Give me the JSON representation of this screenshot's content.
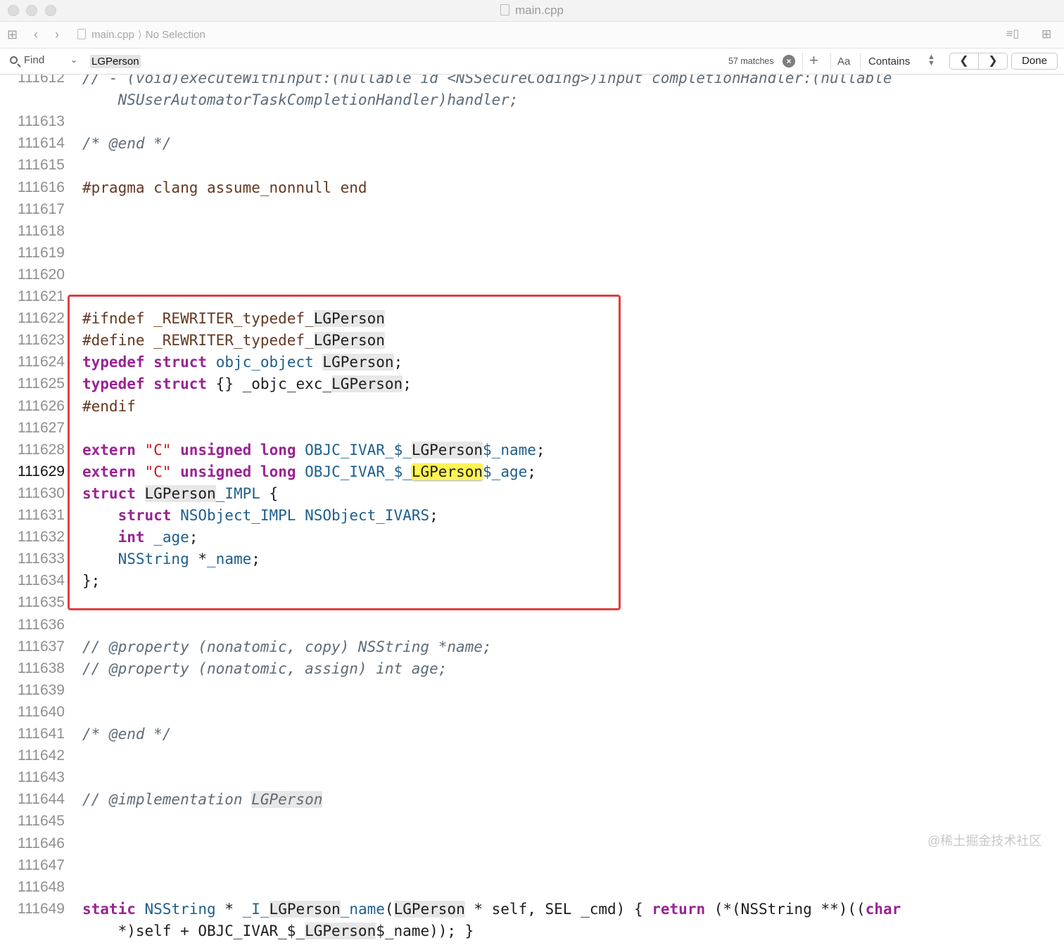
{
  "window": {
    "title": "main.cpp"
  },
  "jumpbar": {
    "file": "main.cpp",
    "selection": "No Selection"
  },
  "findbar": {
    "mode": "Find",
    "query": "LGPerson",
    "match_count": "57 matches",
    "case_label": "Aa",
    "match_type": "Contains",
    "done_label": "Done"
  },
  "editor": {
    "current_line": "111629",
    "lines": [
      {
        "num": "111612",
        "segs": [
          [
            "cmt",
            "// - (void)executeWithInput:(nullable id <NSSecureCoding>)input completionHandler:(nullable"
          ]
        ]
      },
      {
        "num": "",
        "segs": [
          [
            "cmt",
            "    NSUserAutomatorTaskCompletionHandler)handler;"
          ]
        ]
      },
      {
        "num": "111613",
        "segs": []
      },
      {
        "num": "111614",
        "segs": [
          [
            "cmt",
            "/* @end */"
          ]
        ]
      },
      {
        "num": "111615",
        "segs": []
      },
      {
        "num": "111616",
        "segs": [
          [
            "pp",
            "#pragma clang assume_nonnull end"
          ]
        ]
      },
      {
        "num": "111617",
        "segs": []
      },
      {
        "num": "111618",
        "segs": []
      },
      {
        "num": "111619",
        "segs": []
      },
      {
        "num": "111620",
        "segs": []
      },
      {
        "num": "111621",
        "segs": []
      },
      {
        "num": "111622",
        "segs": [
          [
            "pp",
            "#ifndef _REWRITER_typedef_"
          ],
          [
            "hl",
            "LGPerson"
          ]
        ]
      },
      {
        "num": "111623",
        "segs": [
          [
            "pp",
            "#define _REWRITER_typedef_"
          ],
          [
            "hl",
            "LGPerson"
          ]
        ]
      },
      {
        "num": "111624",
        "segs": [
          [
            "kw",
            "typedef"
          ],
          [
            "pl",
            " "
          ],
          [
            "kw",
            "struct"
          ],
          [
            "pl",
            " "
          ],
          [
            "ty",
            "objc_object"
          ],
          [
            "pl",
            " "
          ],
          [
            "hl",
            "LGPerson"
          ],
          [
            "pl",
            ";"
          ]
        ]
      },
      {
        "num": "111625",
        "segs": [
          [
            "kw",
            "typedef"
          ],
          [
            "pl",
            " "
          ],
          [
            "kw",
            "struct"
          ],
          [
            "pl",
            " {} _objc_exc_"
          ],
          [
            "hl",
            "LGPerson"
          ],
          [
            "pl",
            ";"
          ]
        ]
      },
      {
        "num": "111626",
        "segs": [
          [
            "pp",
            "#endif"
          ]
        ]
      },
      {
        "num": "111627",
        "segs": []
      },
      {
        "num": "111628",
        "segs": [
          [
            "kw",
            "extern"
          ],
          [
            "pl",
            " "
          ],
          [
            "str",
            "\"C\""
          ],
          [
            "pl",
            " "
          ],
          [
            "kw",
            "unsigned"
          ],
          [
            "pl",
            " "
          ],
          [
            "kw",
            "long"
          ],
          [
            "pl",
            " "
          ],
          [
            "ty",
            "OBJC_IVAR_$_"
          ],
          [
            "hl",
            "LGPerson"
          ],
          [
            "ty",
            "$_name"
          ],
          [
            "pl",
            ";"
          ]
        ]
      },
      {
        "num": "111629",
        "segs": [
          [
            "kw",
            "extern"
          ],
          [
            "pl",
            " "
          ],
          [
            "str",
            "\"C\""
          ],
          [
            "pl",
            " "
          ],
          [
            "kw",
            "unsigned"
          ],
          [
            "pl",
            " "
          ],
          [
            "kw",
            "long"
          ],
          [
            "pl",
            " "
          ],
          [
            "ty",
            "OBJC_IVAR_$_"
          ],
          [
            "hlcur",
            "LGPerson"
          ],
          [
            "ty",
            "$_age"
          ],
          [
            "pl",
            ";"
          ]
        ]
      },
      {
        "num": "111630",
        "segs": [
          [
            "kw",
            "struct"
          ],
          [
            "pl",
            " "
          ],
          [
            "hl",
            "LGPerson"
          ],
          [
            "ty",
            "_IMPL"
          ],
          [
            "pl",
            " {"
          ]
        ]
      },
      {
        "num": "111631",
        "segs": [
          [
            "pl",
            "    "
          ],
          [
            "kw",
            "struct"
          ],
          [
            "pl",
            " "
          ],
          [
            "ty",
            "NSObject_IMPL"
          ],
          [
            "pl",
            " "
          ],
          [
            "ty",
            "NSObject_IVARS"
          ],
          [
            "pl",
            ";"
          ]
        ]
      },
      {
        "num": "111632",
        "segs": [
          [
            "pl",
            "    "
          ],
          [
            "kw",
            "int"
          ],
          [
            "pl",
            " "
          ],
          [
            "ty",
            "_age"
          ],
          [
            "pl",
            ";"
          ]
        ]
      },
      {
        "num": "111633",
        "segs": [
          [
            "pl",
            "    "
          ],
          [
            "ty",
            "NSString"
          ],
          [
            "pl",
            " *"
          ],
          [
            "ty",
            "_name"
          ],
          [
            "pl",
            ";"
          ]
        ]
      },
      {
        "num": "111634",
        "segs": [
          [
            "pl",
            "};"
          ]
        ]
      },
      {
        "num": "111635",
        "segs": []
      },
      {
        "num": "111636",
        "segs": []
      },
      {
        "num": "111637",
        "segs": [
          [
            "cmt",
            "// @property (nonatomic, copy) NSString *name;"
          ]
        ]
      },
      {
        "num": "111638",
        "segs": [
          [
            "cmt",
            "// @property (nonatomic, assign) int age;"
          ]
        ]
      },
      {
        "num": "111639",
        "segs": []
      },
      {
        "num": "111640",
        "segs": []
      },
      {
        "num": "111641",
        "segs": [
          [
            "cmt",
            "/* @end */"
          ]
        ]
      },
      {
        "num": "111642",
        "segs": []
      },
      {
        "num": "111643",
        "segs": []
      },
      {
        "num": "111644",
        "segs": [
          [
            "cmt",
            "// @implementation "
          ],
          [
            "hlcmt",
            "LGPerson"
          ]
        ]
      },
      {
        "num": "111645",
        "segs": []
      },
      {
        "num": "111646",
        "segs": []
      },
      {
        "num": "111647",
        "segs": []
      },
      {
        "num": "111648",
        "segs": []
      },
      {
        "num": "111649",
        "segs": [
          [
            "kw",
            "static"
          ],
          [
            "pl",
            " "
          ],
          [
            "ty",
            "NSString"
          ],
          [
            "pl",
            " * "
          ],
          [
            "ty",
            "_I_"
          ],
          [
            "hl",
            "LGPerson"
          ],
          [
            "ty",
            "_name"
          ],
          [
            "pl",
            "("
          ],
          [
            "hl",
            "LGPerson"
          ],
          [
            "pl",
            " * self, SEL _cmd) { "
          ],
          [
            "kw",
            "return"
          ],
          [
            "pl",
            " (*(NSString **)(("
          ],
          [
            "kw",
            "char"
          ]
        ]
      },
      {
        "num": "",
        "segs": [
          [
            "pl",
            "    *)self + OBJC_IVAR_$_"
          ],
          [
            "hl",
            "LGPerson"
          ],
          [
            "pl",
            "$_name)); }"
          ]
        ]
      }
    ]
  },
  "watermark": "@稀土掘金技术社区"
}
